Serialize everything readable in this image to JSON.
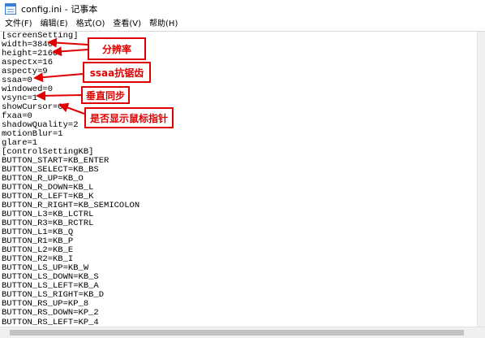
{
  "window": {
    "title": "config.ini - 记事本"
  },
  "menu": [
    "文件(F)",
    "编辑(E)",
    "格式(O)",
    "查看(V)",
    "帮助(H)"
  ],
  "lines": [
    "[screenSetting]",
    "width=3840",
    "height=2160",
    "aspectx=16",
    "aspecty=9",
    "ssaa=0",
    "windowed=0",
    "vsync=1",
    "showCursor=0",
    "fxaa=0",
    "shadowQuality=2",
    "motionBlur=1",
    "glare=1",
    "[controlSettingKB]",
    "BUTTON_START=KB_ENTER",
    "BUTTON_SELECT=KB_BS",
    "BUTTON_R_UP=KB_O",
    "BUTTON_R_DOWN=KB_L",
    "BUTTON_R_LEFT=KB_K",
    "BUTTON_R_RIGHT=KB_SEMICOLON",
    "BUTTON_L3=KB_LCTRL",
    "BUTTON_R3=KB_RCTRL",
    "BUTTON_L1=KB_Q",
    "BUTTON_R1=KB_P",
    "BUTTON_L2=KB_E",
    "BUTTON_R2=KB_I",
    "BUTTON_LS_UP=KB_W",
    "BUTTON_LS_DOWN=KB_S",
    "BUTTON_LS_LEFT=KB_A",
    "BUTTON_LS_RIGHT=KB_D",
    "BUTTON_RS_UP=KP_8",
    "BUTTON_RS_DOWN=KP_2",
    "BUTTON_RS_LEFT=KP_4"
  ],
  "annotations": {
    "resolution": "分辨率",
    "ssaa": "ssaa抗锯齿",
    "vsync": "垂直同步",
    "cursor": "是否显示鼠标指针"
  },
  "colors": {
    "annotation": "#e00000"
  }
}
